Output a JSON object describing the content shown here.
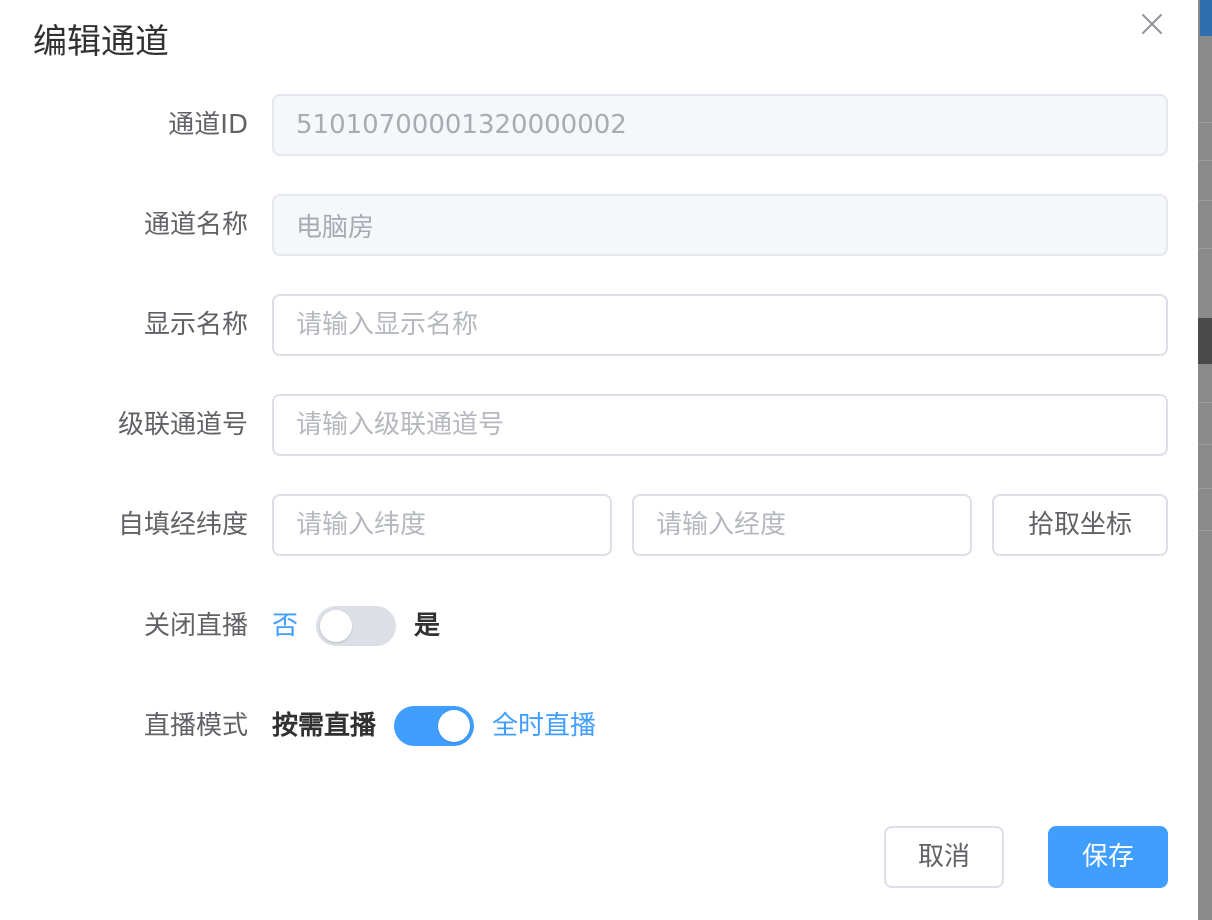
{
  "dialog": {
    "title": "编辑通道",
    "close_icon": "close-icon"
  },
  "form": {
    "channel_id": {
      "label": "通道ID",
      "value": "51010700001320000002",
      "disabled": true
    },
    "channel_name": {
      "label": "通道名称",
      "value": "电脑房",
      "disabled": true
    },
    "display_name": {
      "label": "显示名称",
      "placeholder": "请输入显示名称",
      "value": ""
    },
    "cascade_channel": {
      "label": "级联通道号",
      "placeholder": "请输入级联通道号",
      "value": ""
    },
    "coordinates": {
      "label": "自填经纬度",
      "latitude_placeholder": "请输入纬度",
      "longitude_placeholder": "请输入经度",
      "pick_button": "拾取坐标"
    },
    "close_live": {
      "label": "关闭直播",
      "off_text": "否",
      "on_text": "是",
      "checked": false
    },
    "live_mode": {
      "label": "直播模式",
      "off_text": "按需直播",
      "on_text": "全时直播",
      "checked": true
    }
  },
  "footer": {
    "cancel": "取消",
    "save": "保存"
  },
  "colors": {
    "primary": "#409eff",
    "label": "#606266",
    "border": "#dcdfe6",
    "disabled_bg": "#f5f7fa"
  }
}
